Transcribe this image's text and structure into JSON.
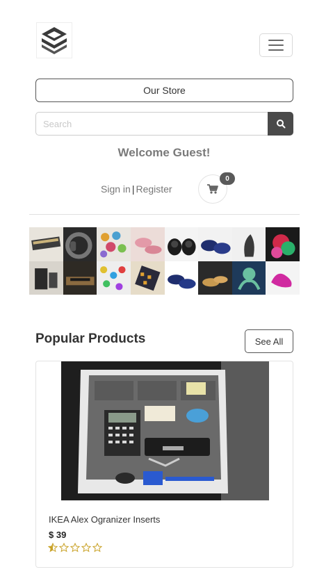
{
  "header": {
    "logo_icon": "cube-logo-icon",
    "menu_icon": "hamburger-menu-icon"
  },
  "store_button_label": "Our Store",
  "search": {
    "placeholder": "Search",
    "value": "",
    "button_icon": "search-icon"
  },
  "welcome_text": "Welcome Guest!",
  "auth": {
    "sign_in": "Sign in",
    "separator": "|",
    "register": "Register"
  },
  "cart": {
    "icon": "shopping-cart-icon",
    "count": "0"
  },
  "popular": {
    "title": "Popular Products",
    "see_all": "See All"
  },
  "products": [
    {
      "name": "IKEA Alex Ogranizer Inserts",
      "price": "$ 39",
      "rating": 0.5,
      "max_rating": 5
    }
  ],
  "colors": {
    "accent_dark": "#4a4a4a",
    "star": "#c9a227",
    "muted_text": "#777777"
  }
}
